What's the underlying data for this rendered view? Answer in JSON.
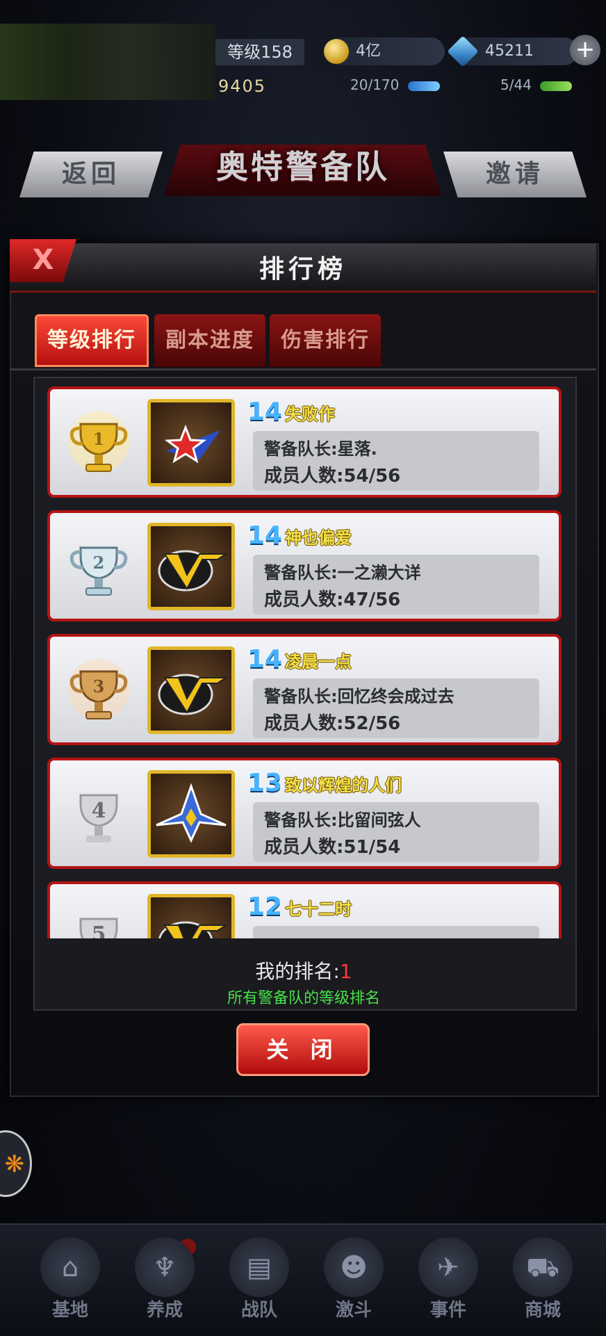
{
  "topbar": {
    "level": "等级158",
    "power": "9405",
    "coins": "4亿",
    "gems": "45211",
    "plus": "+",
    "stamina": "20/170",
    "energy": "5/44"
  },
  "header": {
    "title": "奥特警备队",
    "back_label": "返回",
    "invite_label": "邀请"
  },
  "panel": {
    "close_x": "X",
    "title": "排行榜",
    "tabs": [
      {
        "label": "等级排行",
        "active": true
      },
      {
        "label": "副本进度",
        "active": false
      },
      {
        "label": "伤害排行",
        "active": false
      }
    ]
  },
  "rows": [
    {
      "rank": "1",
      "level": "14",
      "name": "失败作",
      "leader": "警备队长:星落.",
      "members": "成员人数:54/56",
      "trophy_color": "#e9b92a",
      "emblem": "star-emblem"
    },
    {
      "rank": "2",
      "level": "14",
      "name": "神也偏爱",
      "leader": "警备队长:一之濑大详",
      "members": "成员人数:47/56",
      "trophy_color": "#b9d2de",
      "emblem": "v-emblem"
    },
    {
      "rank": "3",
      "level": "14",
      "name": "凌晨一点",
      "leader": "警备队长:回忆终会成过去",
      "members": "成员人数:52/56",
      "trophy_color": "#d7a35a",
      "emblem": "v-emblem"
    },
    {
      "rank": "4",
      "level": "13",
      "name": "致以辉煌的人们",
      "leader": "警备队长:比留间弦人",
      "members": "成员人数:51/54",
      "trophy_color": "#c8c8cc",
      "emblem": "jet-emblem"
    },
    {
      "rank": "5",
      "level": "12",
      "name": "七十二时",
      "leader": "",
      "members": "",
      "trophy_color": "#c8c8cc",
      "emblem": "v-emblem"
    }
  ],
  "footer": {
    "my_rank_label": "我的排名:",
    "my_rank_value": "1",
    "description": "所有警备队的等级排名",
    "close_button": "关 闭"
  },
  "nav": [
    {
      "label": "基地",
      "icon": "base-icon"
    },
    {
      "label": "养成",
      "icon": "training-icon"
    },
    {
      "label": "战队",
      "icon": "team-icon"
    },
    {
      "label": "激斗",
      "icon": "battle-icon"
    },
    {
      "label": "事件",
      "icon": "event-icon"
    },
    {
      "label": "商城",
      "icon": "shop-icon"
    }
  ]
}
